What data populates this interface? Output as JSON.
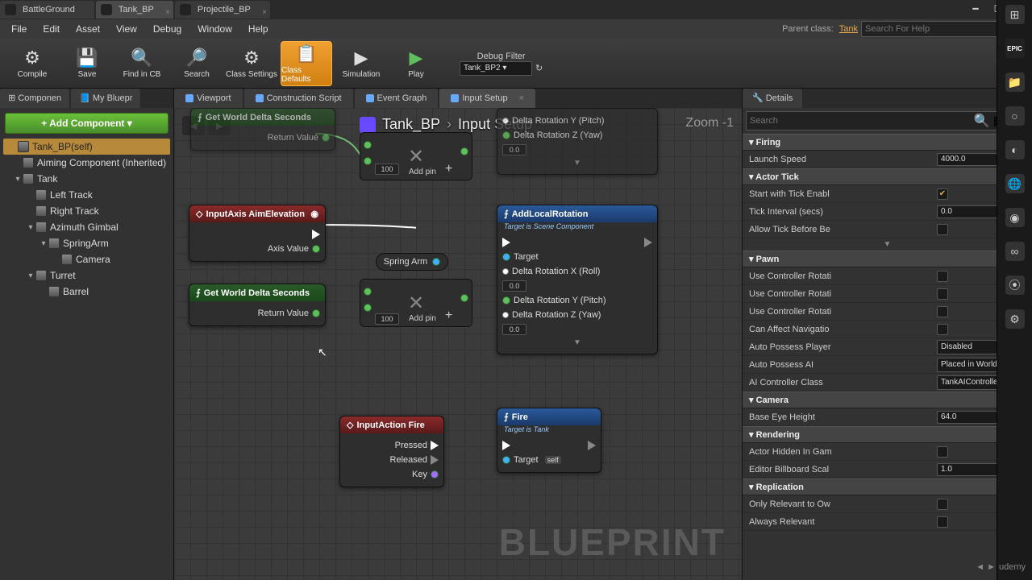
{
  "topTabs": [
    "BattleGround",
    "Tank_BP",
    "Projectile_BP"
  ],
  "menu": [
    "File",
    "Edit",
    "Asset",
    "View",
    "Debug",
    "Window",
    "Help"
  ],
  "parentClassLabel": "Parent class:",
  "parentClass": "Tank",
  "searchHelpPlaceholder": "Search For Help",
  "toolbar": [
    {
      "label": "Compile",
      "icon": "⚙"
    },
    {
      "label": "Save",
      "icon": "💾"
    },
    {
      "label": "Find in CB",
      "icon": "🔍"
    },
    {
      "label": "Search",
      "icon": "🔎"
    },
    {
      "label": "Class Settings",
      "icon": "⚙"
    },
    {
      "label": "Class Defaults",
      "icon": "📋",
      "highlight": true
    },
    {
      "label": "Simulation",
      "icon": "▶"
    },
    {
      "label": "Play",
      "icon": "▶"
    }
  ],
  "debugFilterLabel": "Debug Filter",
  "debugFilterValue": "Tank_BP2 ▾",
  "leftTabs": [
    "Componen",
    "My Bluepr"
  ],
  "addComponent": "+ Add Component ▾",
  "componentTree": [
    {
      "label": "Tank_BP(self)",
      "depth": 0,
      "sel": true
    },
    {
      "label": "Aiming Component (Inherited)",
      "depth": 1
    },
    {
      "label": "Tank",
      "depth": 1,
      "expand": true
    },
    {
      "label": "Left Track",
      "depth": 2
    },
    {
      "label": "Right Track",
      "depth": 2
    },
    {
      "label": "Azimuth Gimbal",
      "depth": 2,
      "expand": true
    },
    {
      "label": "SpringArm",
      "depth": 3,
      "expand": true
    },
    {
      "label": "Camera",
      "depth": 4
    },
    {
      "label": "Turret",
      "depth": 2,
      "expand": true
    },
    {
      "label": "Barrel",
      "depth": 3
    }
  ],
  "graphTabs": [
    {
      "label": "Viewport"
    },
    {
      "label": "Construction Script"
    },
    {
      "label": "Event Graph"
    },
    {
      "label": "Input Setup",
      "active": true
    }
  ],
  "breadcrumb": {
    "root": "Tank_BP",
    "leaf": "Input Setup"
  },
  "zoom": "Zoom -1",
  "watermark": "BLUEPRINT",
  "nodes": {
    "getDelta0": {
      "title": "Get World Delta Seconds",
      "ret": "Return Value"
    },
    "inputAxis": {
      "title": "InputAxis AimElevation",
      "axis": "Axis Value"
    },
    "getDelta1": {
      "title": "Get World Delta Seconds",
      "ret": "Return Value"
    },
    "mult0": {
      "const": "100",
      "addPin": "Add pin"
    },
    "mult1": {
      "const": "100",
      "addPin": "Add pin"
    },
    "springArm": "Spring Arm",
    "addRot": {
      "title": "AddLocalRotation",
      "sub": "Target is Scene Component",
      "target": "Target",
      "roll": "Delta Rotation X (Roll)",
      "rollV": "0.0",
      "pitch": "Delta Rotation Y (Pitch)",
      "yaw": "Delta Rotation Z (Yaw)",
      "yawV": "0.0"
    },
    "addRotTop": {
      "pitch": "Delta Rotation Y (Pitch)",
      "yaw": "Delta Rotation Z (Yaw)",
      "yawV": "0.0"
    },
    "inputFire": {
      "title": "InputAction Fire",
      "pressed": "Pressed",
      "released": "Released",
      "key": "Key"
    },
    "fire": {
      "title": "Fire",
      "sub": "Target is Tank",
      "target": "Target",
      "self": "self"
    }
  },
  "detailsTab": "Details",
  "detailsSearchPlaceholder": "Search",
  "details": {
    "Firing": [
      {
        "label": "Launch Speed",
        "type": "num",
        "value": "4000.0"
      }
    ],
    "Actor Tick": [
      {
        "label": "Start with Tick Enabl",
        "type": "check",
        "value": true
      },
      {
        "label": "Tick Interval (secs)",
        "type": "num",
        "value": "0.0"
      },
      {
        "label": "Allow Tick Before Be",
        "type": "check",
        "value": false
      }
    ],
    "Pawn": [
      {
        "label": "Use Controller Rotati",
        "type": "check",
        "value": false
      },
      {
        "label": "Use Controller Rotati",
        "type": "check",
        "value": false
      },
      {
        "label": "Use Controller Rotati",
        "type": "check",
        "value": false
      },
      {
        "label": "Can Affect Navigatio",
        "type": "check",
        "value": false
      },
      {
        "label": "Auto Possess Player",
        "type": "select",
        "value": "Disabled"
      },
      {
        "label": "Auto Possess AI",
        "type": "select",
        "value": "Placed in World"
      },
      {
        "label": "AI Controller Class",
        "type": "select",
        "value": "TankAIController"
      }
    ],
    "Camera": [
      {
        "label": "Base Eye Height",
        "type": "num",
        "value": "64.0"
      }
    ],
    "Rendering": [
      {
        "label": "Actor Hidden In Gam",
        "type": "check",
        "value": false
      },
      {
        "label": "Editor Billboard Scal",
        "type": "num",
        "value": "1.0"
      }
    ],
    "Replication": [
      {
        "label": "Only Relevant to Ow",
        "type": "check",
        "value": false
      },
      {
        "label": "Always Relevant",
        "type": "check",
        "value": false
      }
    ]
  },
  "udemy": "udemy"
}
